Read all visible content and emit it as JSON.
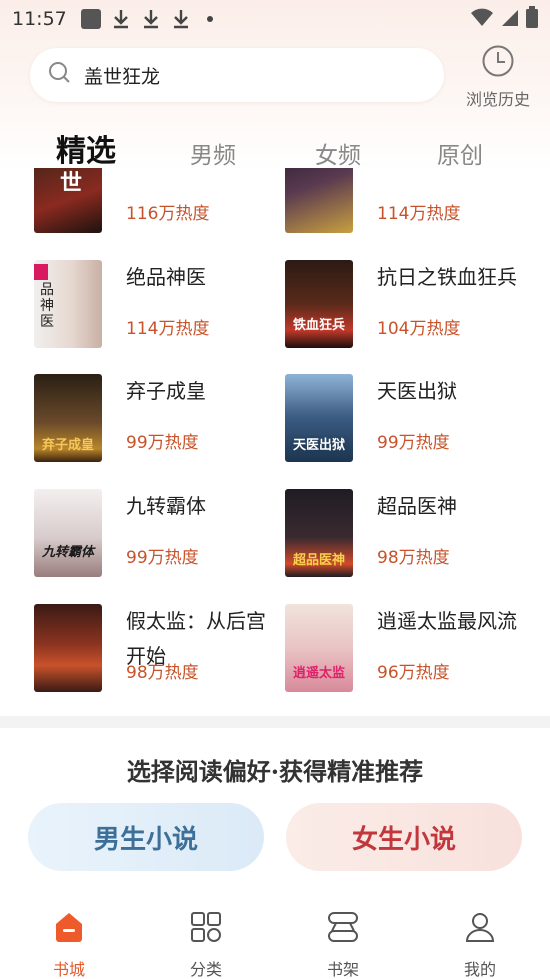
{
  "status_bar": {
    "time": "11:57"
  },
  "search": {
    "query": "盖世狂龙"
  },
  "history": {
    "label": "浏览历史"
  },
  "tabs": [
    {
      "label": "精选",
      "active": true
    },
    {
      "label": "男频",
      "active": false
    },
    {
      "label": "女频",
      "active": false
    },
    {
      "label": "原创",
      "active": false
    }
  ],
  "books": [
    {
      "title": "",
      "heat": "116万热度",
      "cover_text": "世",
      "cover_colors": [
        "#3a2418",
        "#a33"
      ]
    },
    {
      "title": "",
      "heat": "114万热度",
      "cover_text": "",
      "cover_colors": [
        "#2a2030",
        "#c9a040"
      ]
    },
    {
      "title": "绝品神医",
      "heat": "114万热度",
      "cover_text": "品神医",
      "cover_colors": [
        "#f1efee",
        "#c9b0a5"
      ]
    },
    {
      "title": "抗日之铁血狂兵",
      "heat": "104万热度",
      "cover_text": "铁血狂兵",
      "cover_colors": [
        "#2b1b14",
        "#c0392b"
      ]
    },
    {
      "title": "弃子成皇",
      "heat": "99万热度",
      "cover_text": "弃子成皇",
      "cover_colors": [
        "#2a1f14",
        "#b8862b"
      ]
    },
    {
      "title": "天医出狱",
      "heat": "99万热度",
      "cover_text": "天医出狱",
      "cover_colors": [
        "#1c3550",
        "#8fb3d6"
      ]
    },
    {
      "title": "九转霸体",
      "heat": "99万热度",
      "cover_text": "九转霸体",
      "cover_colors": [
        "#f3efee",
        "#9a7d7d"
      ]
    },
    {
      "title": "超品医神",
      "heat": "98万热度",
      "cover_text": "超品医神",
      "cover_colors": [
        "#1f1c24",
        "#d14a2a"
      ]
    },
    {
      "title": "假太监：从后宫开始",
      "heat": "98万热度",
      "cover_text": "",
      "cover_colors": [
        "#3a1a14",
        "#c8522a"
      ]
    },
    {
      "title": "逍遥太监最风流",
      "heat": "96万热度",
      "cover_text": "逍遥太监",
      "cover_colors": [
        "#f1e3dd",
        "#d88a9a"
      ]
    }
  ],
  "preference": {
    "title": "选择阅读偏好·获得精准推荐",
    "male_label": "男生小说",
    "female_label": "女生小说"
  },
  "bottom_nav": [
    {
      "label": "书城",
      "active": true,
      "icon": "home-icon"
    },
    {
      "label": "分类",
      "active": false,
      "icon": "category-icon"
    },
    {
      "label": "书架",
      "active": false,
      "icon": "bookshelf-icon"
    },
    {
      "label": "我的",
      "active": false,
      "icon": "profile-icon"
    }
  ],
  "colors": {
    "accent": "#e55a2b",
    "heat": "#c8532b"
  }
}
